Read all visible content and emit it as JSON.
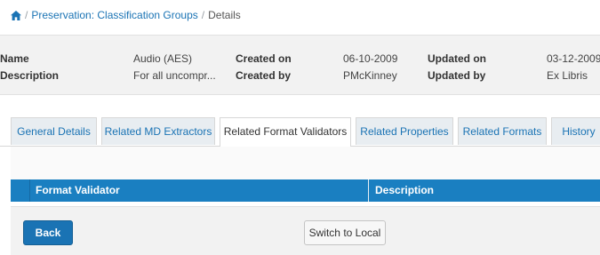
{
  "breadcrumb": {
    "home_icon": "home-icon",
    "separator": "/",
    "link": "Preservation: Classification Groups",
    "current": "Details"
  },
  "summary": {
    "name_label": "Name",
    "name_value": "Audio (AES)",
    "description_label": "Description",
    "description_value": "For all uncompr...",
    "created_on_label": "Created on",
    "created_on_value": "06-10-2009",
    "created_by_label": "Created by",
    "created_by_value": "PMcKinney",
    "updated_on_label": "Updated on",
    "updated_on_value": "03-12-2009",
    "updated_by_label": "Updated by",
    "updated_by_value": "Ex Libris"
  },
  "tabs": [
    {
      "label": "General Details"
    },
    {
      "label": "Related MD Extractors"
    },
    {
      "label": "Related Format Validators",
      "active": true
    },
    {
      "label": "Related Properties"
    },
    {
      "label": "Related Formats"
    },
    {
      "label": "History"
    }
  ],
  "grid": {
    "columns": [
      "Format Validator",
      "Description"
    ]
  },
  "footer": {
    "back_label": "Back",
    "switch_label": "Switch to Local"
  },
  "colors": {
    "accent": "#1a73b4",
    "grid_header": "#1a7fc1",
    "panel_bg": "#f2f2f2",
    "tab_bg": "#e8edf1"
  }
}
